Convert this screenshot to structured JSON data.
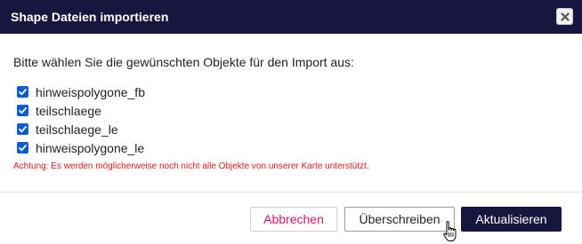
{
  "dialog": {
    "title": "Shape Dateien importieren",
    "close_icon": "close-icon"
  },
  "body": {
    "prompt": "Bitte wählen Sie die gewünschten Objekte für den Import aus:",
    "items": [
      {
        "label": "hinweispolygone_fb",
        "checked": true
      },
      {
        "label": "teilschlaege",
        "checked": true
      },
      {
        "label": "teilschlaege_le",
        "checked": true
      },
      {
        "label": "hinweispolygone_le",
        "checked": true
      }
    ],
    "warning": "Achtung: Es werden möglicherweise noch nicht alle Objekte von unserer Karte unterstützt."
  },
  "footer": {
    "cancel_label": "Abbrechen",
    "overwrite_label": "Überschreiben",
    "update_label": "Aktualisieren"
  },
  "colors": {
    "titlebar": "#16163f",
    "checkbox": "#0a5cd6",
    "warning": "#e01818",
    "cancel_text": "#d4146b",
    "primary_button": "#16163f"
  }
}
